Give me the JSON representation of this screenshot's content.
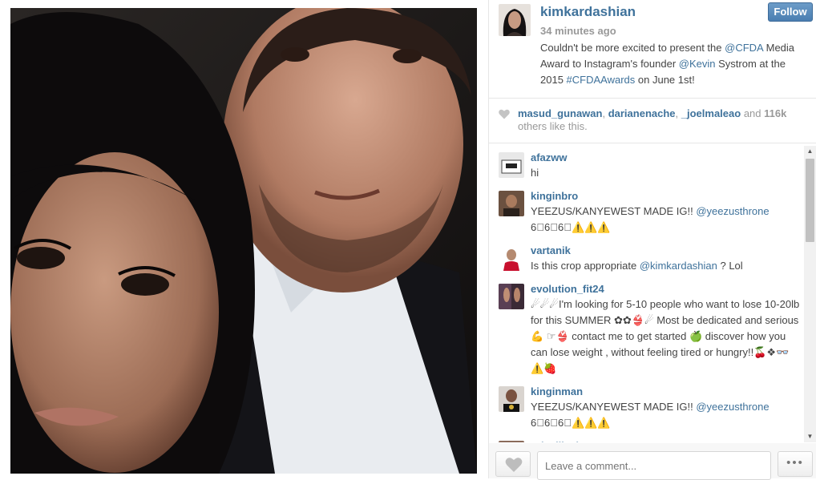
{
  "post": {
    "username": "kimkardashian",
    "follow_label": "Follow",
    "time": "34 minutes ago",
    "caption": {
      "p1": "Couldn't be more excited to present the ",
      "tag1": "@CFDA",
      "p2": " Media Award to Instagram's founder ",
      "tag2": "@Kevin",
      "p3": " Systrom at the 2015 ",
      "tag3": "#CFDAAwards",
      "p4": " on June 1st!"
    }
  },
  "likes": {
    "user1": "masud_gunawan",
    "sep1": ", ",
    "user2": "darianenache",
    "sep2": ", ",
    "user3": "_joelmaleao",
    "and": " and ",
    "count": "116k",
    "rest": " others like this."
  },
  "comments": [
    {
      "username": "afazww",
      "text": "hi"
    },
    {
      "username": "kinginbro",
      "text": "YEEZUS/KANYEWEST MADE IG!! ",
      "mention": "@yeezusthrone",
      "line2": "6⃣6⃣6⃣⚠️⚠️⚠️"
    },
    {
      "username": "vartanik",
      "text": "Is this crop appropriate ",
      "mention": "@kimkardashian",
      "after": " ? Lol"
    },
    {
      "username": "evolution_fit24",
      "text": "☄☄☄I'm looking for 5-10 people who want to lose 10-20lb for this SUMMER ✿✿👙☄ Most be dedicated and serious 💪 ☞👙 contact me to get started 🍏 discover how you can lose weight , without feeling tired or hungry!!🍒❖👓⚠️🍓"
    },
    {
      "username": "kinginman",
      "text": "YEEZUS/KANYEWEST MADE IG!! ",
      "mention": "@yeezusthrone",
      "line2": "6⃣6⃣6⃣⚠️⚠️⚠️"
    },
    {
      "username": "priscilla_lopez"
    }
  ],
  "comment_box": {
    "placeholder": "Leave a comment..."
  },
  "more_label": "•••",
  "icons": {
    "heart": "heart-icon",
    "heart_outline": "heart-outline-icon",
    "scroll_up": "▲",
    "scroll_down": "▼"
  },
  "colors": {
    "link": "#3f729b",
    "follow_button": "#4a7eb1",
    "meta_text": "#999999",
    "body_text": "#444444"
  }
}
